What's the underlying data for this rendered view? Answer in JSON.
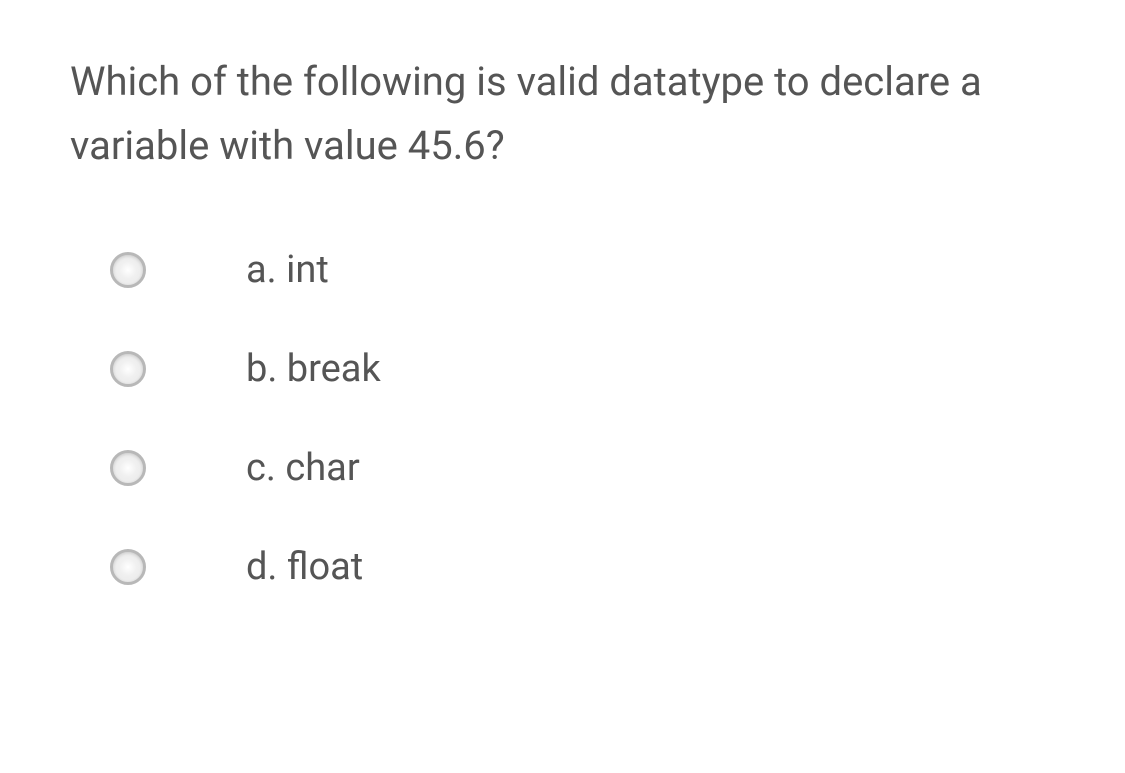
{
  "question": "Which of the following is valid datatype  to declare a variable with value 45.6?",
  "options": [
    {
      "label": "a. int"
    },
    {
      "label": "b. break"
    },
    {
      "label": "c. char"
    },
    {
      "label": "d. float"
    }
  ]
}
